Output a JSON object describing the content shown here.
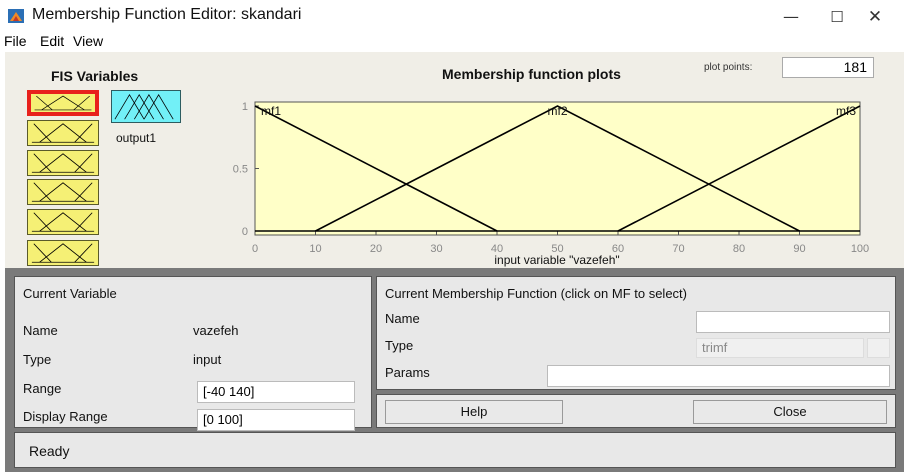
{
  "window": {
    "title": "Membership Function Editor: skandari",
    "minimize_glyph": "—",
    "maximize_glyph": "☐",
    "close_glyph": "✕"
  },
  "menu": [
    "File",
    "Edit",
    "View"
  ],
  "fis": {
    "title": "FIS Variables",
    "input_count": 6,
    "selected_input_index": 0,
    "output_label": "output1",
    "input_color": "#f5f075",
    "output_color": "#72f0f7",
    "selected_border_color": "#e8211c"
  },
  "plot": {
    "title": "Membership function plots",
    "plot_points_label": "plot points:",
    "plot_points_value": "181",
    "xlabel": "input variable \"vazefeh\""
  },
  "chart_data": {
    "type": "line",
    "title": "Membership function plots",
    "xlabel": "input variable \"vazefeh\"",
    "ylabel": "",
    "xlim": [
      0,
      100
    ],
    "ylim": [
      0,
      1
    ],
    "x_ticks": [
      "0",
      "10",
      "20",
      "30",
      "40",
      "50",
      "60",
      "70",
      "80",
      "90",
      "100"
    ],
    "y_ticks": [
      "0",
      "0.5",
      "1"
    ],
    "background": "#ffffc8",
    "series": [
      {
        "name": "mf1",
        "x": [
          0,
          40
        ],
        "y": [
          1,
          0
        ]
      },
      {
        "name": "mf2",
        "x": [
          10,
          50,
          90
        ],
        "y": [
          0,
          1,
          0
        ]
      },
      {
        "name": "mf3",
        "x": [
          60,
          100
        ],
        "y": [
          0,
          1
        ]
      }
    ]
  },
  "current_variable": {
    "title": "Current Variable",
    "name_label": "Name",
    "name_value": "vazefeh",
    "type_label": "Type",
    "type_value": "input",
    "range_label": "Range",
    "range_value": "[-40 140]",
    "display_range_label": "Display Range",
    "display_range_value": "[0 100]"
  },
  "current_mf": {
    "title": "Current Membership Function (click on MF to select)",
    "name_label": "Name",
    "name_value": "",
    "type_label": "Type",
    "type_value": "trimf",
    "params_label": "Params",
    "params_value": ""
  },
  "buttons": {
    "help": "Help",
    "close": "Close"
  },
  "status": "Ready"
}
